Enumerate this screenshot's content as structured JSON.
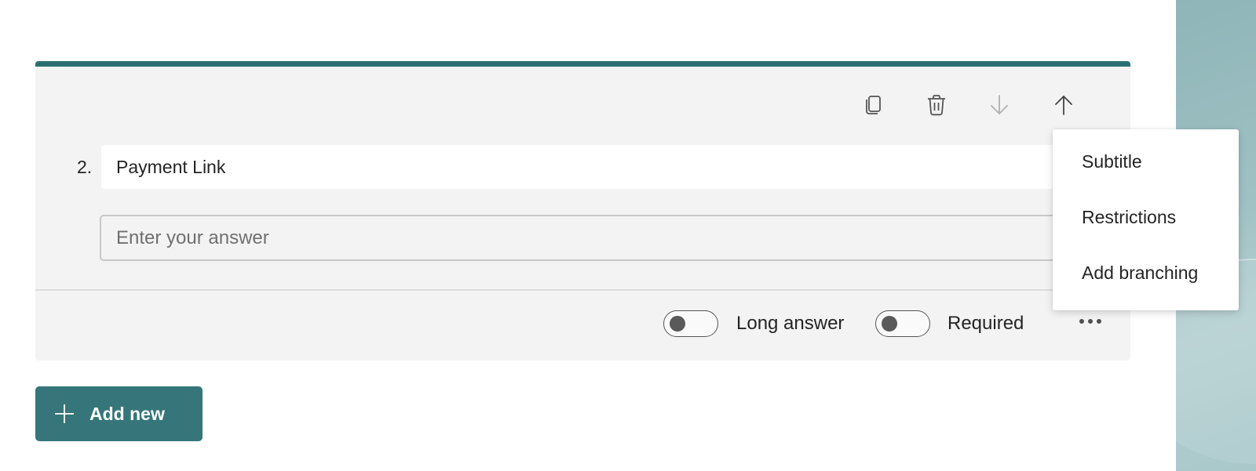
{
  "question": {
    "number": "2.",
    "title": "Payment Link",
    "answer_placeholder": "Enter your answer"
  },
  "toolbar": {
    "icons": [
      "copy-icon",
      "delete-icon",
      "move-down-icon",
      "move-up-icon"
    ]
  },
  "options": {
    "long_answer_label": "Long answer",
    "long_answer_on": false,
    "required_label": "Required",
    "required_on": false
  },
  "more_menu": {
    "items": [
      {
        "label": "Subtitle"
      },
      {
        "label": "Restrictions"
      },
      {
        "label": "Add branching"
      }
    ]
  },
  "add_new": {
    "label": "Add new"
  },
  "colors": {
    "accent": "#2b6f72",
    "button": "#36767a",
    "card_bg": "#f3f3f3"
  }
}
